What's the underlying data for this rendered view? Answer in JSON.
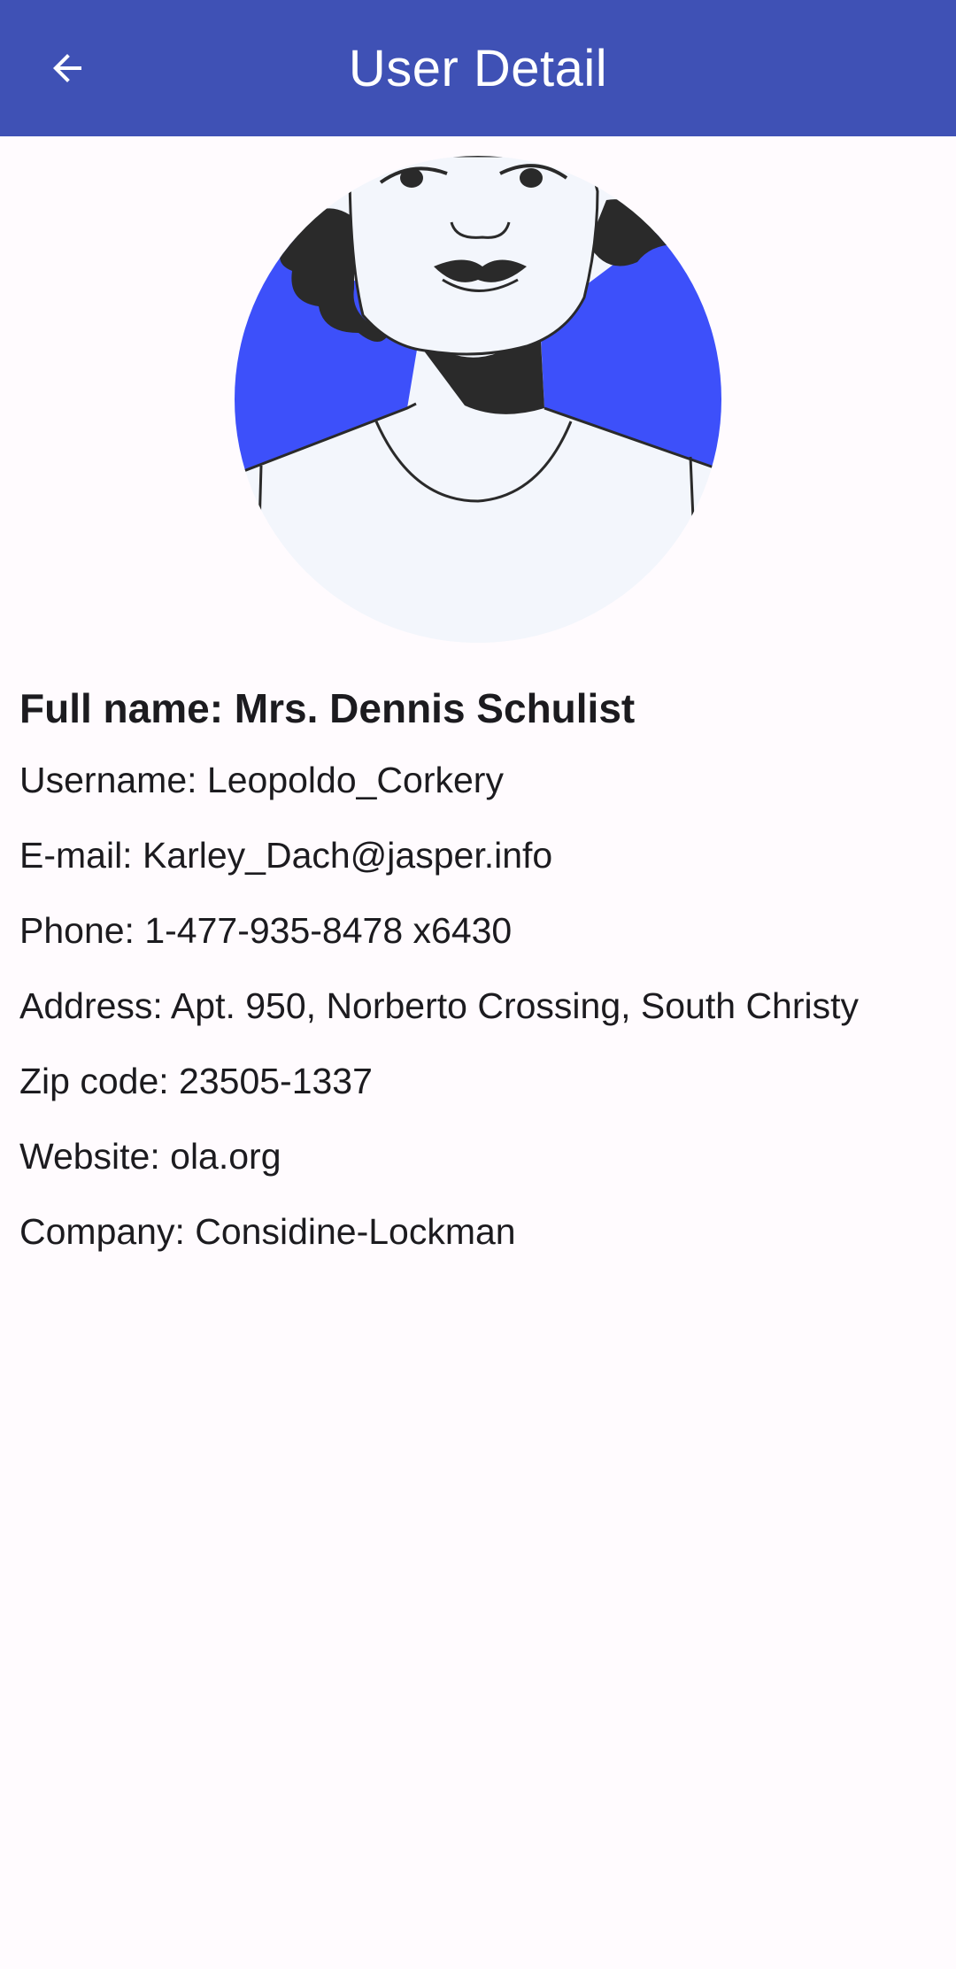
{
  "header": {
    "title": "User Detail",
    "back_icon": "arrow-back-icon"
  },
  "profile": {
    "avatar": "woman-illustration-avatar",
    "full_name": "Full name: Mrs. Dennis Schulist",
    "username": "Username: Leopoldo_Corkery",
    "email": "E-mail: Karley_Dach@jasper.info",
    "phone": "Phone: 1-477-935-8478 x6430",
    "address": "Address: Apt. 950, Norberto Crossing, South Christy",
    "zip": "Zip code: 23505-1337",
    "website": "Website: ola.org",
    "company": "Company: Considine-Lockman"
  },
  "colors": {
    "app_bar": "#3f51b5",
    "background": "#fffbfe",
    "avatar_accent": "#3d50fa",
    "text": "#1c1b1f"
  }
}
